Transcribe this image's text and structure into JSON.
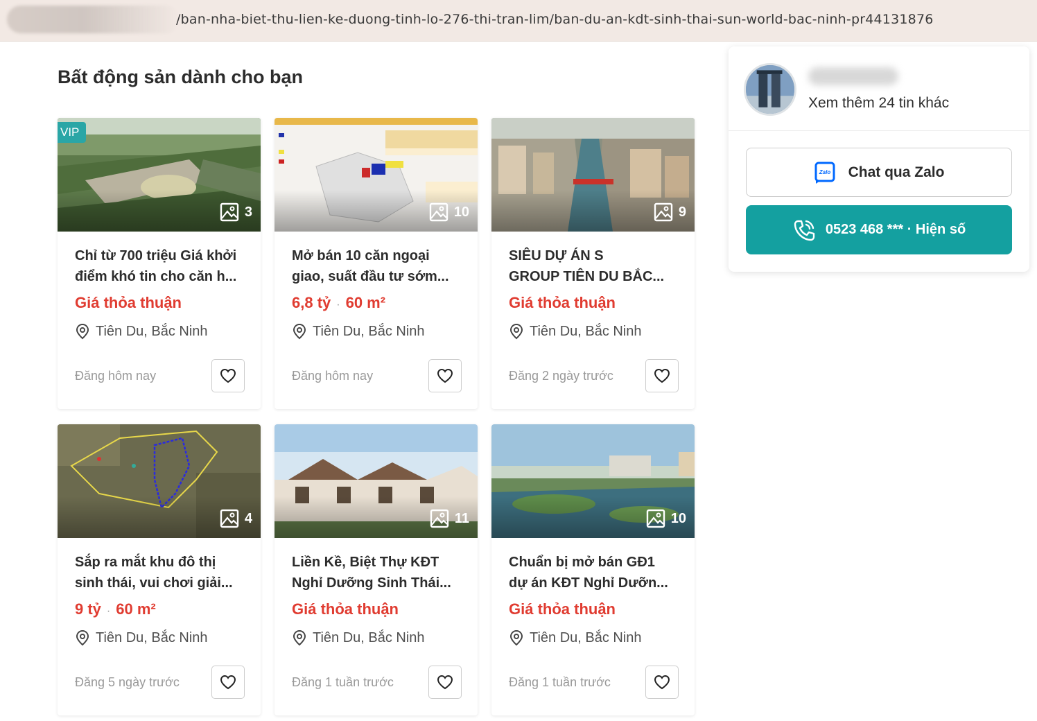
{
  "address_bar": {
    "url_path": "/ban-nha-biet-thu-lien-ke-duong-tinh-lo-276-thi-tran-lim/ban-du-an-kdt-sinh-thai-sun-world-bac-ninh-pr44131876"
  },
  "section": {
    "title": "Bất động sản dành cho bạn"
  },
  "listings": [
    {
      "badge": "VIP",
      "photo_count": "3",
      "title_line1": "Chỉ từ 700 triệu Giá khởi",
      "title_line2": "điểm khó tin cho căn h...",
      "price": "Giá thỏa thuận",
      "area": "",
      "location": "Tiên Du, Bắc Ninh",
      "posted": "Đăng hôm nay"
    },
    {
      "badge": "",
      "photo_count": "10",
      "title_line1": "Mở bán 10 căn ngoại",
      "title_line2": "giao, suất đầu tư sớm...",
      "price": "6,8 tỷ",
      "area": "60 m²",
      "location": "Tiên Du, Bắc Ninh",
      "posted": "Đăng hôm nay"
    },
    {
      "badge": "",
      "photo_count": "9",
      "title_line1": "SIÊU DỰ ÁN S",
      "title_line2": "GROUP TIÊN DU BẮC...",
      "price": "Giá thỏa thuận",
      "area": "",
      "location": "Tiên Du, Bắc Ninh",
      "posted": "Đăng 2 ngày trước"
    },
    {
      "badge": "",
      "photo_count": "4",
      "title_line1": "Sắp ra mắt khu đô thị",
      "title_line2": "sinh thái, vui chơi giải...",
      "price": "9 tỷ",
      "area": "60 m²",
      "location": "Tiên Du, Bắc Ninh",
      "posted": "Đăng 5 ngày trước"
    },
    {
      "badge": "",
      "photo_count": "11",
      "title_line1": "Liền Kề, Biệt Thự KĐT",
      "title_line2": "Nghỉ Dưỡng Sinh Thái...",
      "price": "Giá thỏa thuận",
      "area": "",
      "location": "Tiên Du, Bắc Ninh",
      "posted": "Đăng 1 tuần trước"
    },
    {
      "badge": "",
      "photo_count": "10",
      "title_line1": "Chuẩn bị mở bán GĐ1",
      "title_line2": "dự án KĐT Nghỉ Dưỡn...",
      "price": "Giá thỏa thuận",
      "area": "",
      "location": "Tiên Du, Bắc Ninh",
      "posted": "Đăng 1 tuần trước"
    }
  ],
  "agent": {
    "more_listings": "Xem thêm 24 tin khác",
    "zalo_label": "Chat qua Zalo",
    "zalo_icon_text": "Zalo",
    "phone_label": "0523 468 *** · Hiện số"
  },
  "colors": {
    "price_red": "#e03c31",
    "accent_teal": "#14a0a0",
    "vip_teal": "#2aa6a6"
  }
}
